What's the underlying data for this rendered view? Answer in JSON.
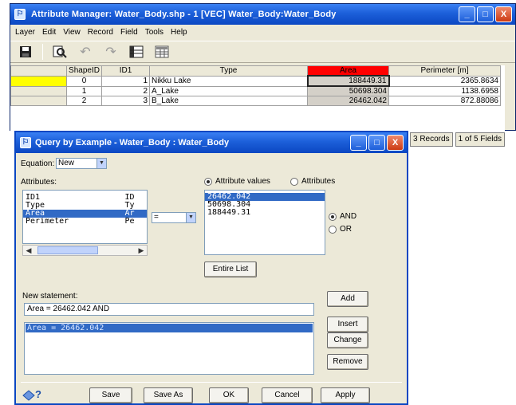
{
  "attribute_manager": {
    "title": "Attribute Manager: Water_Body.shp - 1 [VEC] Water_Body:Water_Body",
    "menu": [
      "Layer",
      "Edit",
      "View",
      "Record",
      "Field",
      "Tools",
      "Help"
    ],
    "toolbar_icons": [
      "save-icon",
      "preview-icon",
      "undo-icon",
      "redo-icon",
      "table-icon",
      "grid-icon"
    ],
    "columns": [
      "ShapeID",
      "ID1",
      "Type",
      "Area",
      "Perimeter [m]"
    ],
    "rows": [
      {
        "shapeid": "0",
        "id1": "1",
        "type": "Nikku Lake",
        "area": "188449.31",
        "perimeter": "2365.8634"
      },
      {
        "shapeid": "1",
        "id1": "2",
        "type": "A_Lake",
        "area": "50698.304",
        "perimeter": "1138.6958"
      },
      {
        "shapeid": "2",
        "id1": "3",
        "type": "B_Lake",
        "area": "26462.042",
        "perimeter": "872.88086"
      }
    ],
    "status": {
      "records": "3 Records",
      "fields": "1 of 5 Fields"
    },
    "window_buttons": {
      "minimize": "_",
      "maximize": "□",
      "close": "X"
    },
    "colors": {
      "titlebar": "#0b47c2",
      "selected_cell": "#ffff00",
      "area_header": "#ff0000"
    }
  },
  "query_dialog": {
    "title": "Query by Example - Water_Body : Water_Body",
    "equation_label": "Equation:",
    "equation_value": "New",
    "attributes_label": "Attributes:",
    "attributes": [
      {
        "name": "ID1",
        "short": "ID"
      },
      {
        "name": "Type",
        "short": "Ty"
      },
      {
        "name": "Area",
        "short": "Ar"
      },
      {
        "name": "Perimeter",
        "short": "Pe"
      }
    ],
    "selected_attribute": "Area",
    "operator": "=",
    "mode_attribute_values": "Attribute values",
    "mode_attributes": "Attributes",
    "values": [
      "26462.042",
      "50698.304",
      "188449.31"
    ],
    "selected_value": "26462.042",
    "logic_and": "AND",
    "logic_or": "OR",
    "entire_list_label": "Entire List",
    "new_statement_label": "New statement:",
    "new_statement_value": "Area = 26462.042 AND",
    "statements": [
      "Area = 26462.042"
    ],
    "side_buttons": {
      "add": "Add",
      "insert": "Insert",
      "change": "Change",
      "remove": "Remove"
    },
    "footer_buttons": {
      "save": "Save",
      "save_as": "Save As",
      "ok": "OK",
      "cancel": "Cancel",
      "apply": "Apply"
    },
    "help_icon_label": "?"
  }
}
